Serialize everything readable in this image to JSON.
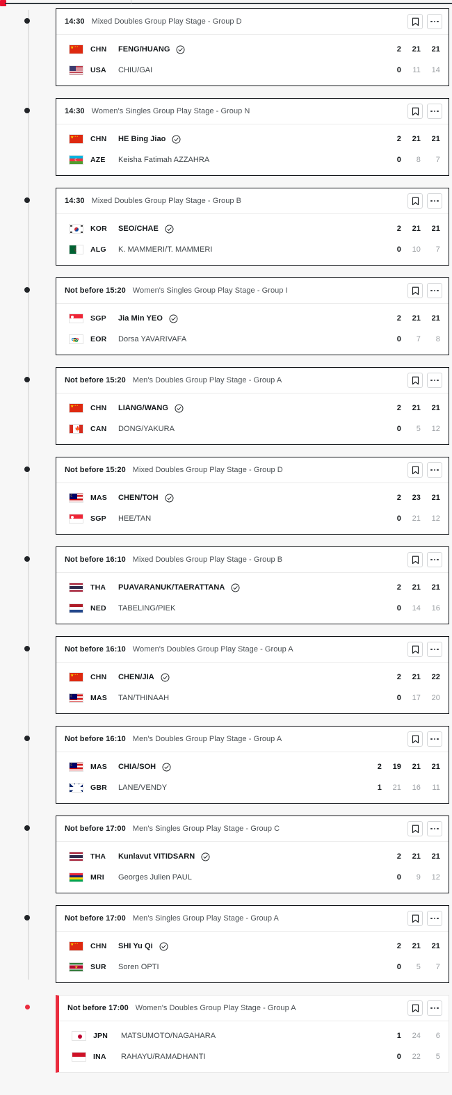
{
  "page": {
    "background": "#f7f7f7",
    "accent_live": "#ea2c3e",
    "card_border": "#111418"
  },
  "icons": {
    "bookmark": "bookmark-icon",
    "more": "more-options-icon",
    "winner": "winner-check-icon"
  },
  "matches": [
    {
      "time": "14:30",
      "title": "Mixed Doubles Group Play Stage - Group D",
      "live": false,
      "competitors": [
        {
          "flag": "f-chn",
          "flag_name": "flag-china",
          "noc": "CHN",
          "name": "FENG/HUANG",
          "winner": true,
          "scores": [
            "2",
            "21",
            "21"
          ]
        },
        {
          "flag": "f-usa",
          "flag_name": "flag-usa",
          "noc": "USA",
          "name": "CHIU/GAI",
          "winner": false,
          "scores": [
            "0",
            "11",
            "14"
          ]
        }
      ]
    },
    {
      "time": "14:30",
      "title": "Women's Singles Group Play Stage - Group N",
      "live": false,
      "competitors": [
        {
          "flag": "f-chn",
          "flag_name": "flag-china",
          "noc": "CHN",
          "name": "HE Bing Jiao",
          "winner": true,
          "scores": [
            "2",
            "21",
            "21"
          ]
        },
        {
          "flag": "f-aze",
          "flag_name": "flag-azerbaijan",
          "noc": "AZE",
          "name": "Keisha Fatimah AZZAHRA",
          "winner": false,
          "scores": [
            "0",
            "8",
            "7"
          ]
        }
      ]
    },
    {
      "time": "14:30",
      "title": "Mixed Doubles Group Play Stage - Group B",
      "live": false,
      "competitors": [
        {
          "flag": "f-kor",
          "flag_name": "flag-korea",
          "noc": "KOR",
          "name": "SEO/CHAE",
          "winner": true,
          "scores": [
            "2",
            "21",
            "21"
          ]
        },
        {
          "flag": "f-alg",
          "flag_name": "flag-algeria",
          "noc": "ALG",
          "name": "K. MAMMERI/T. MAMMERI",
          "winner": false,
          "scores": [
            "0",
            "10",
            "7"
          ]
        }
      ]
    },
    {
      "time": "Not before 15:20",
      "title": "Women's Singles Group Play Stage - Group I",
      "live": false,
      "competitors": [
        {
          "flag": "f-sgp",
          "flag_name": "flag-singapore",
          "noc": "SGP",
          "name": "Jia Min YEO",
          "winner": true,
          "scores": [
            "2",
            "21",
            "21"
          ]
        },
        {
          "flag": "f-eor",
          "flag_name": "flag-refugee-team",
          "noc": "EOR",
          "name": "Dorsa YAVARIVAFA",
          "winner": false,
          "scores": [
            "0",
            "7",
            "8"
          ]
        }
      ]
    },
    {
      "time": "Not before 15:20",
      "title": "Men's Doubles Group Play Stage - Group A",
      "live": false,
      "competitors": [
        {
          "flag": "f-chn",
          "flag_name": "flag-china",
          "noc": "CHN",
          "name": "LIANG/WANG",
          "winner": true,
          "scores": [
            "2",
            "21",
            "21"
          ]
        },
        {
          "flag": "f-can",
          "flag_name": "flag-canada",
          "noc": "CAN",
          "name": "DONG/YAKURA",
          "winner": false,
          "scores": [
            "0",
            "5",
            "12"
          ]
        }
      ]
    },
    {
      "time": "Not before 15:20",
      "title": "Mixed Doubles Group Play Stage - Group D",
      "live": false,
      "competitors": [
        {
          "flag": "f-mas",
          "flag_name": "flag-malaysia",
          "noc": "MAS",
          "name": "CHEN/TOH",
          "winner": true,
          "scores": [
            "2",
            "23",
            "21"
          ]
        },
        {
          "flag": "f-sgp",
          "flag_name": "flag-singapore",
          "noc": "SGP",
          "name": "HEE/TAN",
          "winner": false,
          "scores": [
            "0",
            "21",
            "12"
          ]
        }
      ]
    },
    {
      "time": "Not before 16:10",
      "title": "Mixed Doubles Group Play Stage - Group B",
      "live": false,
      "competitors": [
        {
          "flag": "f-tha",
          "flag_name": "flag-thailand",
          "noc": "THA",
          "name": "PUAVARANUK/TAERATTANA",
          "winner": true,
          "scores": [
            "2",
            "21",
            "21"
          ]
        },
        {
          "flag": "f-ned",
          "flag_name": "flag-netherlands",
          "noc": "NED",
          "name": "TABELING/PIEK",
          "winner": false,
          "scores": [
            "0",
            "14",
            "16"
          ]
        }
      ]
    },
    {
      "time": "Not before 16:10",
      "title": "Women's Doubles Group Play Stage - Group A",
      "live": false,
      "competitors": [
        {
          "flag": "f-chn",
          "flag_name": "flag-china",
          "noc": "CHN",
          "name": "CHEN/JIA",
          "winner": true,
          "scores": [
            "2",
            "21",
            "22"
          ]
        },
        {
          "flag": "f-mas",
          "flag_name": "flag-malaysia",
          "noc": "MAS",
          "name": "TAN/THINAAH",
          "winner": false,
          "scores": [
            "0",
            "17",
            "20"
          ]
        }
      ]
    },
    {
      "time": "Not before 16:10",
      "title": "Men's Doubles Group Play Stage - Group A",
      "live": false,
      "competitors": [
        {
          "flag": "f-mas",
          "flag_name": "flag-malaysia",
          "noc": "MAS",
          "name": "CHIA/SOH",
          "winner": true,
          "scores": [
            "2",
            "19",
            "21",
            "21"
          ]
        },
        {
          "flag": "f-gbr",
          "flag_name": "flag-great-britain",
          "noc": "GBR",
          "name": "LANE/VENDY",
          "winner": false,
          "scores": [
            "1",
            "21",
            "16",
            "11"
          ]
        }
      ]
    },
    {
      "time": "Not before 17:00",
      "title": "Men's Singles Group Play Stage - Group C",
      "live": false,
      "competitors": [
        {
          "flag": "f-tha",
          "flag_name": "flag-thailand",
          "noc": "THA",
          "name": "Kunlavut VITIDSARN",
          "winner": true,
          "scores": [
            "2",
            "21",
            "21"
          ]
        },
        {
          "flag": "f-mri",
          "flag_name": "flag-mauritius",
          "noc": "MRI",
          "name": "Georges Julien PAUL",
          "winner": false,
          "scores": [
            "0",
            "9",
            "12"
          ]
        }
      ]
    },
    {
      "time": "Not before 17:00",
      "title": "Men's Singles Group Play Stage - Group A",
      "live": false,
      "competitors": [
        {
          "flag": "f-chn",
          "flag_name": "flag-china",
          "noc": "CHN",
          "name": "SHI Yu Qi",
          "winner": true,
          "scores": [
            "2",
            "21",
            "21"
          ]
        },
        {
          "flag": "f-sur",
          "flag_name": "flag-suriname",
          "noc": "SUR",
          "name": "Soren OPTI",
          "winner": false,
          "scores": [
            "0",
            "5",
            "7"
          ]
        }
      ]
    },
    {
      "time": "Not before 17:00",
      "title": "Women's Doubles Group Play Stage - Group A",
      "live": true,
      "competitors": [
        {
          "flag": "f-jpn",
          "flag_name": "flag-japan",
          "noc": "JPN",
          "name": "MATSUMOTO/NAGAHARA",
          "winner": false,
          "scores": [
            "1",
            "24",
            "6"
          ]
        },
        {
          "flag": "f-ina",
          "flag_name": "flag-indonesia",
          "noc": "INA",
          "name": "RAHAYU/RAMADHANTI",
          "winner": false,
          "scores": [
            "0",
            "22",
            "5"
          ]
        }
      ]
    }
  ]
}
